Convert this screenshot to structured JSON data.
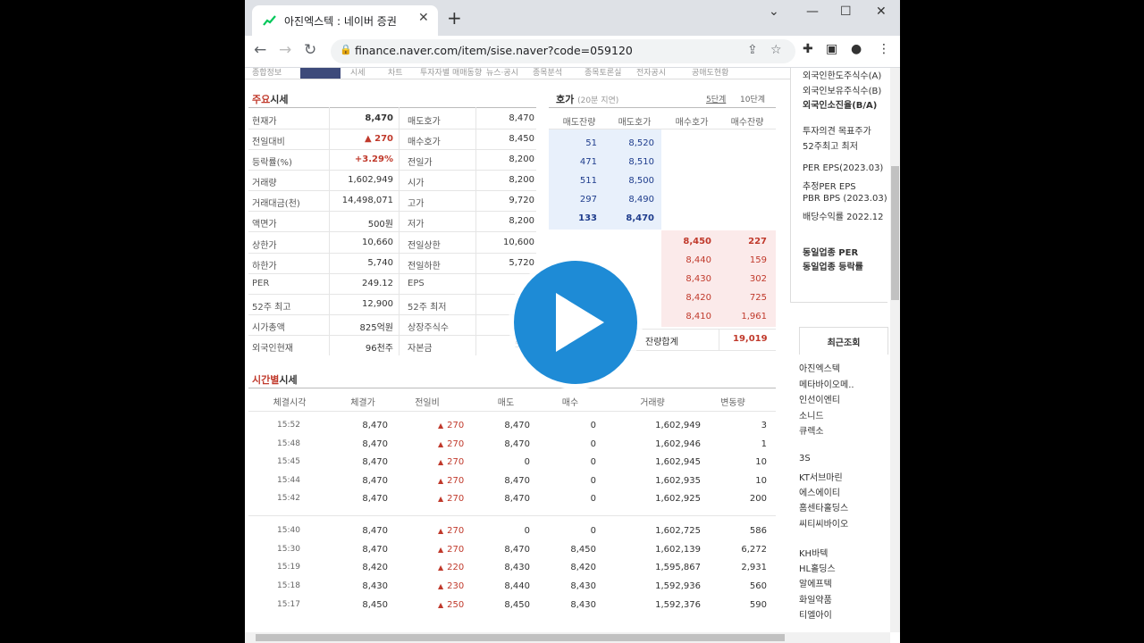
{
  "browser": {
    "tab_title": "아진엑스텍 : 네이버 증권",
    "url": "finance.naver.com/item/sise.naver?code=059120"
  },
  "subtab_labels": [
    "종합정보",
    "시세",
    "차트",
    "투자자별 매매동향",
    "뉴스·공시",
    "종목분석",
    "종목토론실",
    "전자공시",
    "공매도현황"
  ],
  "main_quote": {
    "title_hl": "주요",
    "title_rest": "시세",
    "left": [
      {
        "label": "현재가",
        "value": "8,470",
        "style": "bold"
      },
      {
        "label": "전일대비",
        "value": "▲ 270",
        "style": "red"
      },
      {
        "label": "등락률(%)",
        "value": "+3.29%",
        "style": "red"
      },
      {
        "label": "거래량",
        "value": "1,602,949",
        "style": ""
      },
      {
        "label": "거래대금(천)",
        "value": "14,498,071",
        "style": ""
      },
      {
        "label": "액면가",
        "value": "500원",
        "style": ""
      },
      {
        "label": "상한가",
        "value": "10,660",
        "style": ""
      },
      {
        "label": "하한가",
        "value": "5,740",
        "style": ""
      },
      {
        "label": "PER",
        "value": "249.12",
        "style": ""
      },
      {
        "label": "52주 최고",
        "value": "12,900",
        "style": ""
      },
      {
        "label": "시가총액",
        "value": "825억원",
        "style": ""
      },
      {
        "label": "외국인현재",
        "value": "96천주",
        "style": ""
      }
    ],
    "right": [
      {
        "label": "매도호가",
        "value": "8,470"
      },
      {
        "label": "매수호가",
        "value": "8,450"
      },
      {
        "label": "전일가",
        "value": "8,200"
      },
      {
        "label": "시가",
        "value": "8,200"
      },
      {
        "label": "고가",
        "value": "9,720"
      },
      {
        "label": "저가",
        "value": "8,200"
      },
      {
        "label": "전일상한",
        "value": "10,600"
      },
      {
        "label": "전일하한",
        "value": "5,720"
      },
      {
        "label": "EPS",
        "value": ""
      },
      {
        "label": "52주 최저",
        "value": ""
      },
      {
        "label": "상장주식수",
        "value": "9,7"
      },
      {
        "label": "자본금",
        "value": "5,07"
      }
    ]
  },
  "orderbook": {
    "title": "호가",
    "delay": "(20분 지연)",
    "opt1": "5단계",
    "opt2": "10단계",
    "headers": [
      "매도잔량",
      "매도호가",
      "매수호가",
      "매수잔량"
    ],
    "ask": [
      {
        "qty": "51",
        "price": "8,520"
      },
      {
        "qty": "471",
        "price": "8,510"
      },
      {
        "qty": "511",
        "price": "8,500"
      },
      {
        "qty": "297",
        "price": "8,490"
      },
      {
        "qty": "133",
        "price": "8,470"
      }
    ],
    "bid": [
      {
        "price": "8,450",
        "qty": "227"
      },
      {
        "price": "8,440",
        "qty": "159"
      },
      {
        "price": "8,430",
        "qty": "302"
      },
      {
        "price": "8,420",
        "qty": "725"
      },
      {
        "price": "8,410",
        "qty": "1,961"
      }
    ],
    "total_label": "잔량합계",
    "total_bid": "19,019"
  },
  "time_quote": {
    "title_hl": "시간별",
    "title_rest": "시세",
    "headers": [
      "체결시각",
      "체결가",
      "전일비",
      "매도",
      "매수",
      "거래량",
      "변동량"
    ],
    "group1": [
      {
        "time": "15:52",
        "price": "8,470",
        "diff": "270",
        "sell": "8,470",
        "buy": "0",
        "vol": "1,602,949",
        "chg": "3"
      },
      {
        "time": "15:48",
        "price": "8,470",
        "diff": "270",
        "sell": "8,470",
        "buy": "0",
        "vol": "1,602,946",
        "chg": "1"
      },
      {
        "time": "15:45",
        "price": "8,470",
        "diff": "270",
        "sell": "0",
        "buy": "0",
        "vol": "1,602,945",
        "chg": "10"
      },
      {
        "time": "15:44",
        "price": "8,470",
        "diff": "270",
        "sell": "8,470",
        "buy": "0",
        "vol": "1,602,935",
        "chg": "10"
      },
      {
        "time": "15:42",
        "price": "8,470",
        "diff": "270",
        "sell": "8,470",
        "buy": "0",
        "vol": "1,602,925",
        "chg": "200"
      }
    ],
    "group2": [
      {
        "time": "15:40",
        "price": "8,470",
        "diff": "270",
        "sell": "0",
        "buy": "0",
        "vol": "1,602,725",
        "chg": "586"
      },
      {
        "time": "15:30",
        "price": "8,470",
        "diff": "270",
        "sell": "8,470",
        "buy": "8,450",
        "vol": "1,602,139",
        "chg": "6,272"
      },
      {
        "time": "15:19",
        "price": "8,420",
        "diff": "220",
        "sell": "8,430",
        "buy": "8,420",
        "vol": "1,595,867",
        "chg": "2,931"
      },
      {
        "time": "15:18",
        "price": "8,430",
        "diff": "230",
        "sell": "8,440",
        "buy": "8,430",
        "vol": "1,592,936",
        "chg": "560"
      },
      {
        "time": "15:17",
        "price": "8,450",
        "diff": "250",
        "sell": "8,450",
        "buy": "8,430",
        "vol": "1,592,376",
        "chg": "590"
      }
    ]
  },
  "side": {
    "info": [
      "외국인한도주식수(A)",
      "외국인보유주식수(B)",
      "외국인소진율(B/A)",
      "투자의견   목표주가",
      "52주최고   최저",
      "PER  EPS(2023.03)",
      "추정PER  EPS",
      "PBR  BPS (2023.03)",
      "배당수익률  2022.12",
      "동일업종 PER",
      "동일업종 등락률"
    ],
    "recent_title": "최근조회",
    "recent": [
      "아진엑스텍",
      "메타바이오메..",
      "인선이엔티",
      "소니드",
      "큐렉소",
      "3S",
      "KT서브마린",
      "에스에이티",
      "홈센타홀딩스",
      "씨티씨바이오",
      "KH바텍",
      "HL홀딩스",
      "알에프텍",
      "화일약품",
      "티엘아이"
    ]
  },
  "colors": {
    "up": "#c0392b",
    "accent": "#3d4a7a",
    "play": "#1e8bd6"
  }
}
